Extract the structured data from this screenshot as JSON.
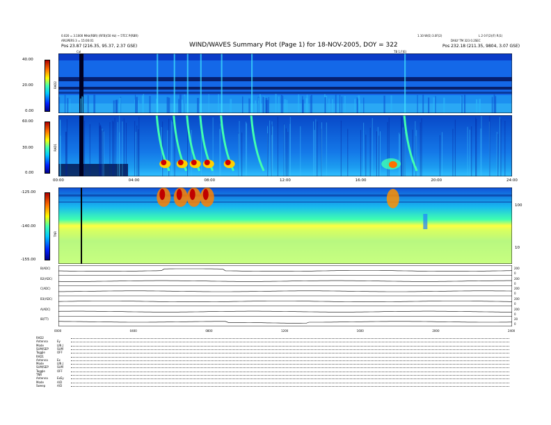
{
  "header": {
    "title": "WIND/WAVES Summary Plot (Page 1) for 18-NOV-2005, DOY = 322",
    "left_line1": "0.020 = 3.1000 MHz(RBR) (RFB)(50 Hz) ~ 5TCC P(RBR)",
    "left_line2": "ARGPERS 3 = 15:00:01",
    "left_line3": "Pos    23.87 (216.35, 95.37, 2.37 GSE)",
    "right_line1": "DAILY TM 323 0.2SEC",
    "right_line2": "Pos   232.18 (211.35, 9804, 3.07 GSE)",
    "top_center_small": "1.10 W(E) 3.0F(2)",
    "top_right_small": "L 2 0 F(2)(F) R(1)",
    "cal_label": "Cal",
    "ticklabel_1800": "TB 1.F(E)"
  },
  "colors": {
    "background": "#ffffff",
    "jet_low": "#00008a",
    "jet_mid": "#40ffb0",
    "jet_high": "#b00000",
    "tnr_band": "#ffff40"
  },
  "chart_data": [
    {
      "type": "heatmap",
      "panel": "RAD2",
      "ylabel": "RAD2",
      "colorbar_ticks": [
        "40.00",
        "20.00",
        "0.00"
      ],
      "x_range_hours": [
        0,
        24
      ]
    },
    {
      "type": "heatmap",
      "panel": "RAD1",
      "ylabel": "RAD1",
      "colorbar_ticks": [
        "60.00",
        "30.00",
        "0.00"
      ],
      "x_ticks": [
        "00:00",
        "04:00",
        "08:00",
        "12:00",
        "16:00",
        "20:00",
        "24:00"
      ],
      "x_range_hours": [
        0,
        24
      ],
      "events_hours": [
        5.2,
        6.1,
        6.8,
        7.5,
        8.6,
        10.2,
        18.3
      ]
    },
    {
      "type": "heatmap",
      "panel": "TNR",
      "ylabel": "TNR",
      "colorbar_ticks": [
        "-125.00",
        "-140.00",
        "-155.00"
      ],
      "right_ticks": [
        "100",
        "10"
      ],
      "x_range_hours": [
        0,
        24
      ]
    },
    {
      "type": "line",
      "panel": "housekeeping",
      "rows": [
        {
          "label": "B(ADC)",
          "right_ticks": [
            "200",
            "0"
          ]
        },
        {
          "label": "B2(ADC)",
          "right_ticks": [
            "200",
            "0"
          ]
        },
        {
          "label": "C(ADC)",
          "right_ticks": [
            "200",
            "0"
          ]
        },
        {
          "label": "B3(ADC)",
          "right_ticks": [
            "200",
            "0"
          ]
        },
        {
          "label": "A(ADC)",
          "right_ticks": [
            "200",
            "0"
          ]
        },
        {
          "label": "IB(TT)",
          "right_ticks": [
            "20",
            "0"
          ]
        }
      ],
      "x_ticks": [
        "0000",
        "0400",
        "0800",
        "1200",
        "1600",
        "2000",
        "2400"
      ]
    }
  ],
  "legend": {
    "rows": [
      {
        "label": "RAD2",
        "value": ""
      },
      {
        "label": "Antenna",
        "value": "Ey"
      },
      {
        "label": "Mode",
        "value": "LIN J"
      },
      {
        "label": "SUM/SEP",
        "value": "SUM"
      },
      {
        "label": "Toggle",
        "value": "OFF"
      },
      {
        "label": "RAD1",
        "value": ""
      },
      {
        "label": "Antenna",
        "value": "Ex"
      },
      {
        "label": "Mode",
        "value": "LIN J"
      },
      {
        "label": "SUM/SEP",
        "value": "SUM"
      },
      {
        "label": "Toggle",
        "value": "OFF"
      },
      {
        "label": "TNR",
        "value": ""
      },
      {
        "label": "Antenna",
        "value": "ExEy"
      },
      {
        "label": "Mode",
        "value": "A/D"
      },
      {
        "label": "Sweep",
        "value": "A/D"
      }
    ]
  }
}
